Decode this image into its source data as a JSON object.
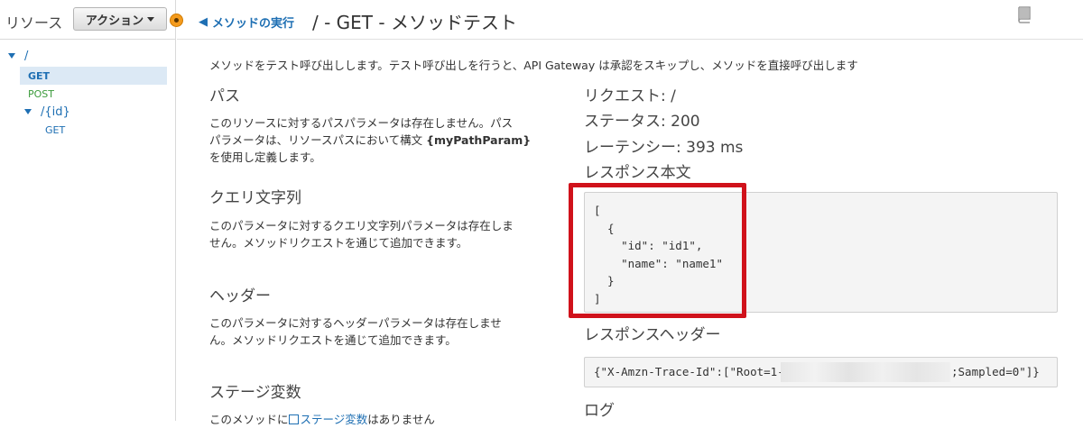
{
  "sidebar": {
    "title": "リソース",
    "action_button": "アクション",
    "tree": [
      {
        "label": "/",
        "type": "resource"
      },
      {
        "label": "GET",
        "type": "method-get-selected"
      },
      {
        "label": "POST",
        "type": "method-post"
      },
      {
        "label": "/{id}",
        "type": "resource"
      },
      {
        "label": "GET",
        "type": "method-get"
      }
    ]
  },
  "header": {
    "back_link": "メソッドの実行",
    "title": "/ - GET - メソッドテスト"
  },
  "description": "メソッドをテスト呼び出しします。テスト呼び出しを行うと、API Gateway は承認をスキップし、メソッドを直接呼び出します",
  "left": {
    "path_heading": "パス",
    "path_text_1": "このリソースに対するパスパラメータは存在しません。パス",
    "path_text_2": "パラメータは、リソースパスにおいて構文",
    "path_text_param": "{myPathParam}",
    "path_text_3": "を使用し定義します。",
    "query_heading": "クエリ文字列",
    "query_text_1": "このパラメータに対するクエリ文字列パラメータは存在しま",
    "query_text_2": "せん。メソッドリクエストを通じて追加できます。",
    "header_heading": "ヘッダー",
    "header_text_1": "このパラメータに対するヘッダーパラメータは存在しませ",
    "header_text_2": "ん。メソッドリクエストを通じて追加できます。",
    "stage_heading": "ステージ変数",
    "stage_text_prefix": "このメソッドに",
    "stage_text_link": "ステージ変数",
    "stage_text_suffix": "はありません"
  },
  "right": {
    "request": "リクエスト: /",
    "status": "ステータス: 200",
    "latency": "レーテンシー: 393 ms",
    "response_body_heading": "レスポンス本文",
    "response_body": "[\n  {\n    \"id\": \"id1\",\n    \"name\": \"name1\"\n  }\n]",
    "response_headers_heading": "レスポンスヘッダー",
    "response_headers_prefix": "{\"X-Amzn-Trace-Id\":[\"Root=1-62",
    "response_headers_suffix": ";Sampled=0\"]}",
    "log_heading": "ログ"
  },
  "colors": {
    "accent": "#1e6fb3",
    "highlight": "#d0121b",
    "post": "#3c9b3c"
  }
}
